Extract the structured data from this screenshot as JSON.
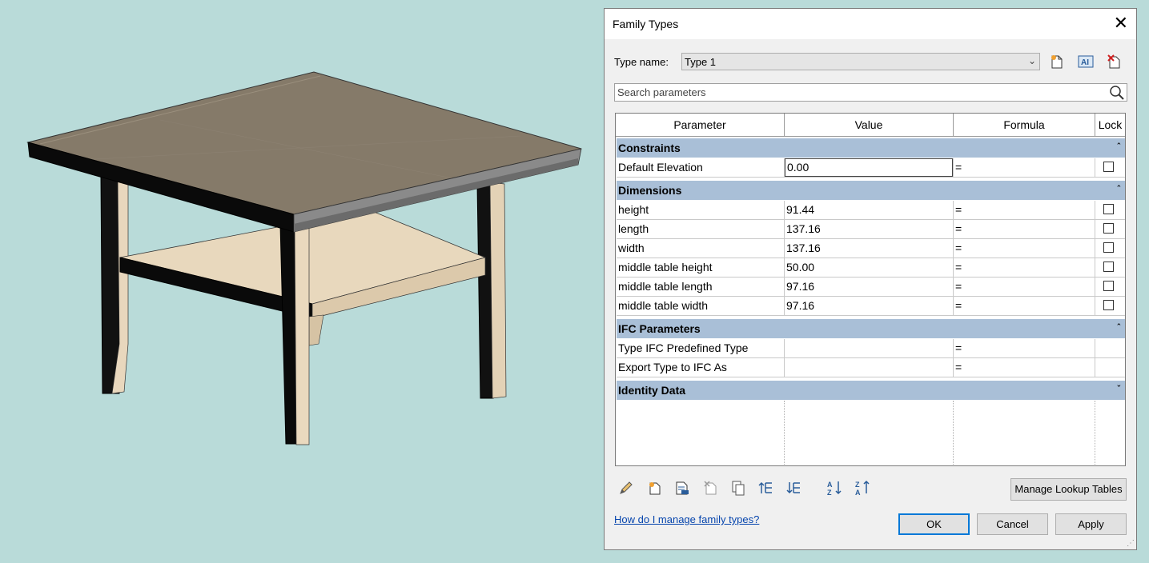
{
  "dialog": {
    "title": "Family Types",
    "type_name_label": "Type name:",
    "type_name_value": "Type 1",
    "search_placeholder": "Search parameters",
    "columns": [
      "Parameter",
      "Value",
      "Formula",
      "Lock"
    ],
    "groups": [
      {
        "name": "Constraints",
        "rows": [
          {
            "param": "Default Elevation",
            "value": "0.00",
            "formula": "=",
            "lock": false
          }
        ]
      },
      {
        "name": "Dimensions",
        "rows": [
          {
            "param": "height",
            "value": "91.44",
            "formula": "=",
            "lock": false
          },
          {
            "param": "length",
            "value": "137.16",
            "formula": "=",
            "lock": false
          },
          {
            "param": "width",
            "value": "137.16",
            "formula": "=",
            "lock": false
          },
          {
            "param": "middle table height",
            "value": "50.00",
            "formula": "=",
            "lock": false
          },
          {
            "param": "middle table length",
            "value": "97.16",
            "formula": "=",
            "lock": false
          },
          {
            "param": "middle table width",
            "value": "97.16",
            "formula": "=",
            "lock": false
          }
        ]
      },
      {
        "name": "IFC Parameters",
        "rows": [
          {
            "param": "Type IFC Predefined Type",
            "value": "",
            "formula": "=",
            "lock": null
          },
          {
            "param": "Export Type to IFC As",
            "value": "",
            "formula": "=",
            "lock": null
          }
        ]
      },
      {
        "name": "Identity Data",
        "rows": []
      }
    ],
    "manage_lookup_label": "Manage Lookup Tables",
    "help_link": "How do I manage family types?",
    "ok_label": "OK",
    "cancel_label": "Cancel",
    "apply_label": "Apply"
  },
  "colors": {
    "viewport_bg": "#b9dbd9",
    "group_header": "#a9bfd7",
    "table_top": "#837867",
    "table_wood": "#e6d6bb",
    "table_black": "#0a0a0a"
  }
}
